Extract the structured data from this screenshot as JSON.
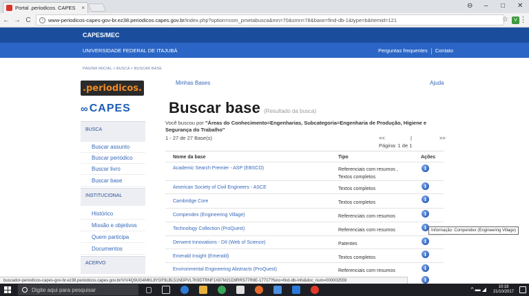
{
  "browser": {
    "tab_title": "Portal .periodicos. CAPES",
    "tab_close": "×",
    "url_host": "www-periodicos-capes-gov-br.ez38.periodicos.capes.gov.br",
    "url_path": "/index.php?option=com_pmetabusca&mn=70&smn=78&base=find-db-1&type=b&Itemid=121",
    "info_glyph": "i",
    "back": "←",
    "forward": "→",
    "reload": "C",
    "star": "☆",
    "ext_label": "V",
    "menu": "⋮",
    "win_user": "⊖",
    "win_min": "–",
    "win_max": "□",
    "win_close": "✕"
  },
  "header": {
    "capes_label": "CAPES/MEC",
    "university": "UNIVERSIDADE FEDERAL DE ITAJUBÁ",
    "faq": "Perguntas frequentes",
    "contato": "Contato"
  },
  "breadcrumb": "PÁGINA INICIAL > BUSCA > BUSCAR BASE",
  "logos": {
    "periodicos": ".periodicos.",
    "capes": "CAPES",
    "capes_mark": "∞"
  },
  "sidebar": {
    "busca_head": "BUSCA",
    "busca_items": [
      "Buscar assunto",
      "Buscar periódico",
      "Buscar livro",
      "Buscar base"
    ],
    "institucional_head": "INSTITUCIONAL",
    "institucional_items": [
      "Histórico",
      "Missão e objetivos",
      "Quem participa",
      "Documentos"
    ],
    "acervo_head": "ACERVO"
  },
  "main": {
    "minhas_bases": "Minhas Bases",
    "ajuda": "Ajuda",
    "title": "Buscar base",
    "subtitle": "(Resultado da busca)",
    "busca_prefix": "Você buscou por ",
    "busca_query": "\"Áreas do Conhecimento=Engenharias, Subcategoria=Engenharia de Produção, Higiene e Segurança do Trabalho\"",
    "count": "1 - 27 de 27 Base(s)",
    "pager_prev": "<<",
    "pager_bar": "|",
    "pager_next": ">>",
    "pagina": "Página: 1 de 1"
  },
  "table": {
    "headers": [
      "Nome da base",
      "Tipo",
      "Ações"
    ],
    "rows": [
      {
        "nome": "Academic Search Premier - ASP (EBSCO)",
        "tipo": "Referenciais com resumos , Textos completos"
      },
      {
        "nome": "American Society of Civil Engineers - ASCE",
        "tipo": "Textos completos"
      },
      {
        "nome": "Cambridge Core",
        "tipo": "Textos completos"
      },
      {
        "nome": "Compendex (Engineering Village)",
        "tipo": "Referenciais com resumos"
      },
      {
        "nome": "Technology Collection (ProQuest)",
        "tipo": "Referenciais com resumos"
      },
      {
        "nome": "Derwent Innovations - DII (Web of Science)",
        "tipo": "Patentes"
      },
      {
        "nome": "Emerald Insight (Emerald)",
        "tipo": "Textos completos"
      },
      {
        "nome": "Environmental Engineering Abstracts (ProQuest)",
        "tipo": "Referenciais com resumos"
      }
    ],
    "info_glyph": "i"
  },
  "tooltip": "Informação: Compendex (Engineering Village)",
  "status_url": "buscador-periodicos-capes-gov-br.ez38.periodicos.capes.gov.br/V/V4Q9UG4MKL8YGF9LBL51NDPVL7K9DTRNF1X87M21D9RRS77R9E-17717?func=find-db-info&doc_num=000002559",
  "taskbar": {
    "search_placeholder": "Digite aqui para pesquisar",
    "time": "10:18",
    "date": "21/10/2017",
    "tray_icons": "^ ▬ ◢"
  }
}
